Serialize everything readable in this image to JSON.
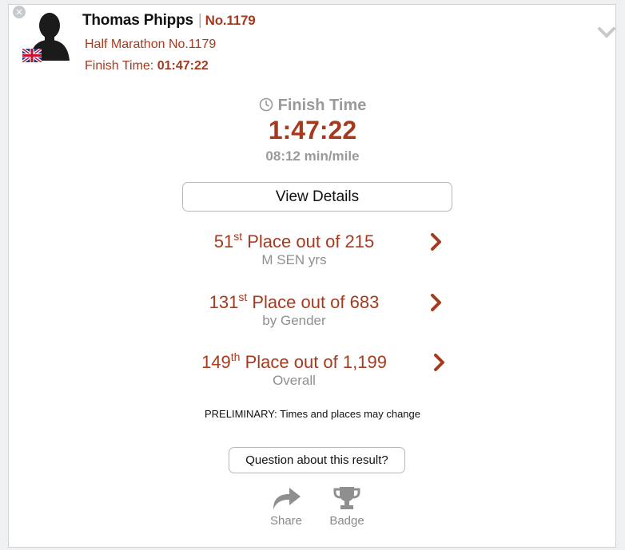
{
  "athlete": {
    "name": "Thomas Phipps",
    "separator": "|",
    "bib": "No.1179",
    "race": "Half Marathon No.1179",
    "finish_label": "Finish Time:",
    "finish_value": "01:47:22",
    "flag_icon": "uk-flag-icon",
    "avatar_icon": "person-silhouette-icon"
  },
  "summary": {
    "heading": "Finish Time",
    "time": "1:47:22",
    "pace": "08:12 min/mile"
  },
  "view_details_label": "View Details",
  "places": [
    {
      "rank": "51",
      "suffix": "st",
      "text": " Place out of 215",
      "category": "M SEN yrs"
    },
    {
      "rank": "131",
      "suffix": "st",
      "text": " Place out of 683",
      "category": "by Gender"
    },
    {
      "rank": "149",
      "suffix": "th",
      "text": " Place out of 1,199",
      "category": "Overall"
    }
  ],
  "notice": "PRELIMINARY: Times and places may change",
  "question_label": "Question about this result?",
  "actions": {
    "share_label": "Share",
    "badge_label": "Badge"
  },
  "colors": {
    "accent": "#a63a1f",
    "muted": "#9a9a9a",
    "border": "#b7b7b7"
  }
}
